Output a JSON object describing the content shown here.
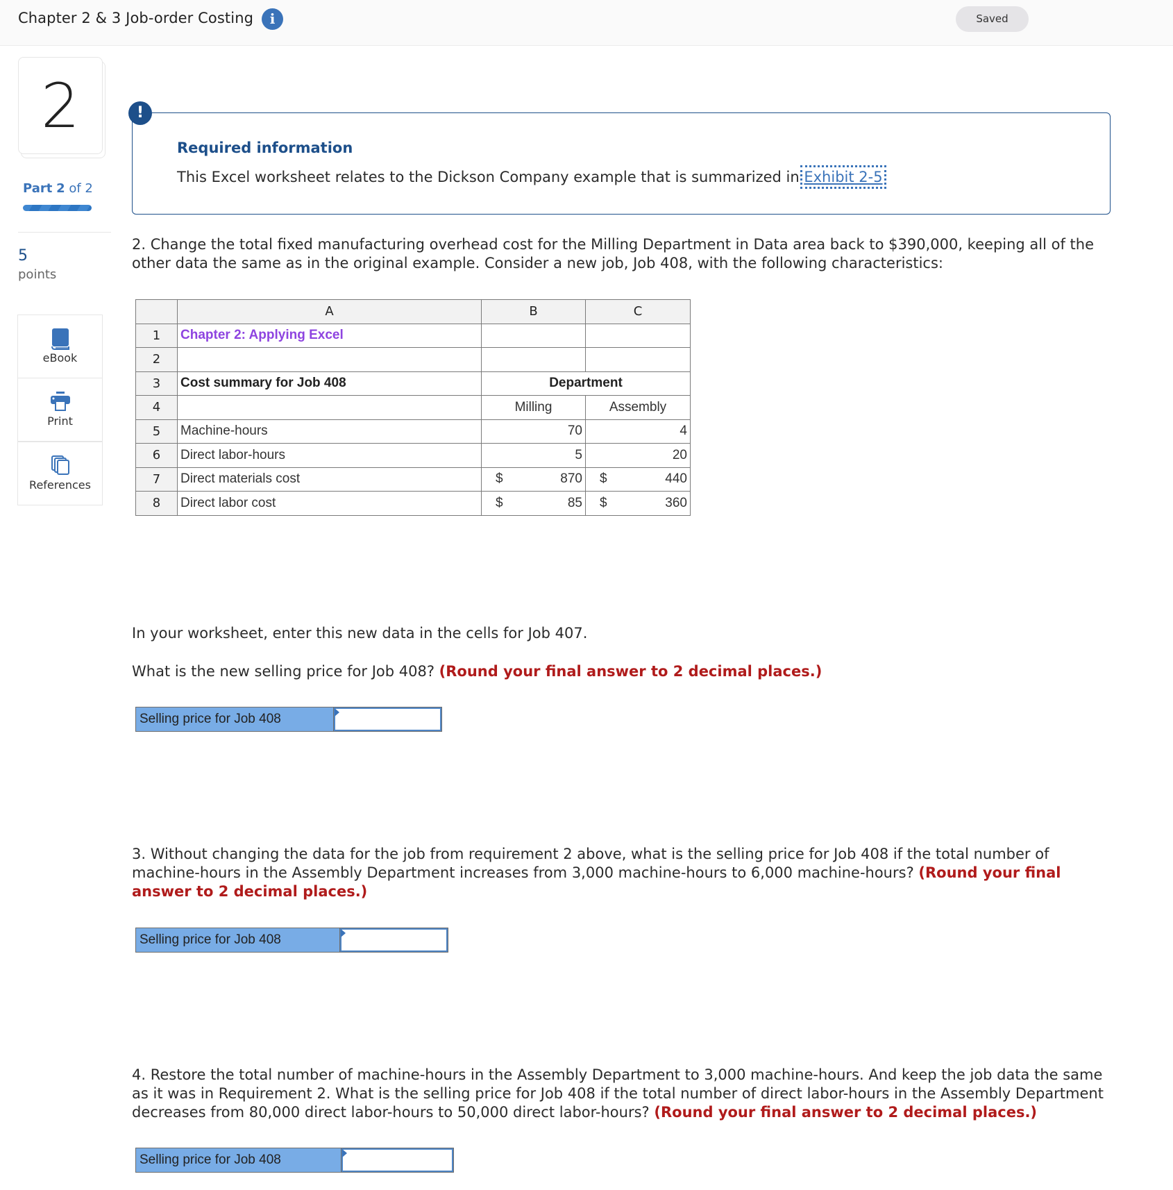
{
  "header": {
    "title": "Chapter 2 & 3 Job-order Costing",
    "info_icon": "info-icon",
    "status": "Saved"
  },
  "rail": {
    "question_number": "2",
    "part_label": "Part",
    "part_current": "2",
    "part_total_text": "of 2",
    "progress_fraction": 1.0,
    "points_value": "5",
    "points_label": "points",
    "tools": [
      {
        "label": "eBook",
        "icon": "book-icon"
      },
      {
        "label": "Print",
        "icon": "printer-icon"
      },
      {
        "label": "References",
        "icon": "copy-pages-icon"
      }
    ]
  },
  "required_info": {
    "badge": "!",
    "heading": "Required information",
    "text": "This Excel worksheet relates to the Dickson Company example that is summarized in",
    "link": "Exhibit 2-5"
  },
  "q2": {
    "prompt": "2. Change the total fixed manufacturing overhead cost for the Milling Department in Data area back to $390,000, keeping all of the other data the same as in the original example. Consider a new job, Job 408, with the following characteristics:",
    "instruction": "In your worksheet, enter this new data in the cells for Job 407.",
    "question": "What is the new selling price for Job 408?",
    "round_note": "(Round your final answer to 2 decimal places.)",
    "answer_label": "Selling price for Job 408",
    "answer_value": ""
  },
  "sheet": {
    "col_headers": [
      "A",
      "B",
      "C"
    ],
    "rows": [
      {
        "n": "1",
        "a": "Chapter 2: Applying Excel",
        "b": "",
        "c": ""
      },
      {
        "n": "2",
        "a": "",
        "b": "",
        "c": ""
      },
      {
        "n": "3",
        "a": "Cost summary for Job 408",
        "bc_merged": "Department"
      },
      {
        "n": "4",
        "a": "",
        "b": "Milling",
        "c": "Assembly"
      },
      {
        "n": "5",
        "a": "Machine-hours",
        "b": "70",
        "c": "4"
      },
      {
        "n": "6",
        "a": "Direct labor-hours",
        "b": "5",
        "c": "20"
      },
      {
        "n": "7",
        "a": "Direct materials cost",
        "b_cur": "$",
        "b": "870",
        "c_cur": "$",
        "c": "440"
      },
      {
        "n": "8",
        "a": "Direct labor cost",
        "b_cur": "$",
        "b": "85",
        "c_cur": "$",
        "c": "360"
      }
    ]
  },
  "q3": {
    "prompt": "3. Without changing the data for the job from requirement 2 above, what is the selling price for Job 408 if the total number of machine-hours in the Assembly Department increases from 3,000 machine-hours to 6,000 machine-hours?",
    "round_note": "(Round your final answer to 2 decimal places.)",
    "answer_label": "Selling price for Job 408",
    "answer_value": ""
  },
  "q4": {
    "prompt": "4. Restore the total number of machine-hours in the Assembly Department to 3,000 machine-hours. And keep the job data the same as it was in Requirement 2. What is the selling price for Job 408 if the total number of direct labor-hours in the Assembly Department decreases from 80,000 direct labor-hours to 50,000 direct labor-hours?",
    "round_note": "(Round your final answer to 2 decimal places.)",
    "answer_label": "Selling price for Job 408",
    "answer_value": ""
  }
}
